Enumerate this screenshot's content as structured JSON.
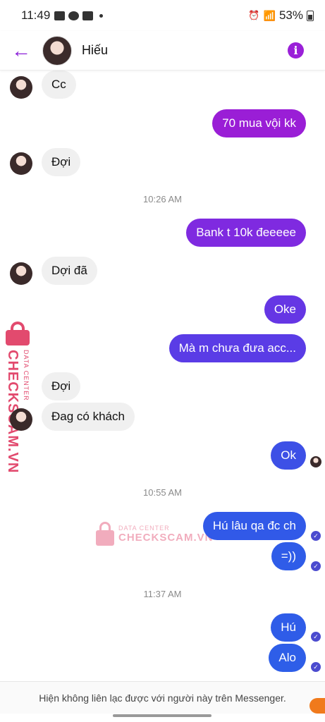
{
  "status": {
    "time": "11:49",
    "battery": "53%"
  },
  "header": {
    "name": "Hiếu"
  },
  "messages": [
    {
      "text": "Cc"
    },
    {
      "text": "70 mua vội kk"
    },
    {
      "text": "Đợi"
    },
    {
      "text": "Bank t 10k đeeeee"
    },
    {
      "text": "Dợi đã"
    },
    {
      "text": "Oke"
    },
    {
      "text": "Mà m chưa đưa acc..."
    },
    {
      "text": "Đợi"
    },
    {
      "text": "Đag có khách"
    },
    {
      "text": "Ok"
    },
    {
      "text": "Hú lâu qa đc ch"
    },
    {
      "text": "=))"
    },
    {
      "text": "Hú"
    },
    {
      "text": "Alo"
    }
  ],
  "timestamps": [
    "10:26 AM",
    "10:55 AM",
    "11:37 AM"
  ],
  "watermark": {
    "brand": "CHECKSCAM.VN",
    "tagline": "DATA CENTER"
  },
  "footer": {
    "notice": "Hiện không liên lạc được với người này trên Messenger."
  },
  "colors": {
    "accent": "#8b1fd8",
    "bubble_top": "#9a1ed6",
    "bubble_bottom": "#2e5ee8"
  }
}
